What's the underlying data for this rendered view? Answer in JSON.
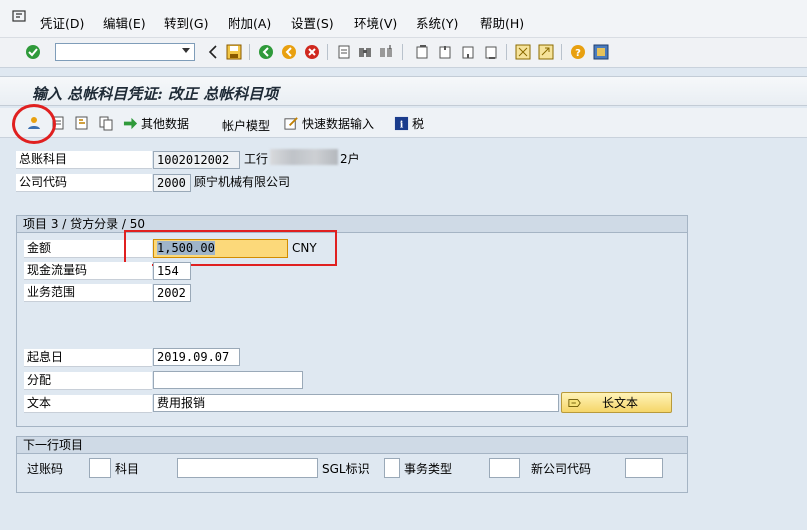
{
  "menu": {
    "items": [
      "凭证(D)",
      "编辑(E)",
      "转到(G)",
      "附加(A)",
      "设置(S)",
      "环境(V)",
      "系统(Y)",
      "帮助(H)"
    ]
  },
  "toolbar": {
    "command_field_value": ""
  },
  "title": "输入 总帐科目凭证: 改正 总帐科目项",
  "app_toolbar": {
    "other_data": "其他数据",
    "account_model": "帐户模型",
    "fast_entry": "快速数据输入",
    "tax": "税"
  },
  "header_fields": {
    "gl_account_label": "总账科目",
    "gl_account_value": "1002012002",
    "gl_account_desc_prefix": "工行",
    "gl_account_desc_suffix": "2户",
    "company_code_label": "公司代码",
    "company_code_value": "2000",
    "company_name": "顾宁机械有限公司"
  },
  "item_group": {
    "title": "项目 3 / 贷方分录 / 50",
    "amount_label": "金额",
    "amount_value": "1,500.00",
    "currency": "CNY",
    "cashflow_label": "现金流量码",
    "cashflow_value": "154",
    "business_area_label": "业务范围",
    "business_area_value": "2002",
    "value_date_label": "起息日",
    "value_date_value": "2019.09.07",
    "assignment_label": "分配",
    "assignment_value": "",
    "text_label": "文本",
    "text_value": "费用报销",
    "long_text_button": "长文本"
  },
  "next_item_group": {
    "title": "下一行项目",
    "posting_key_label": "过账码",
    "account_label": "科目",
    "sgl_label": "SGL标识",
    "trans_type_label": "事务类型",
    "new_company_label": "新公司代码"
  },
  "colors": {
    "background": "#dfe8f1",
    "highlight_red": "#e02020",
    "amount_field": "#fcd97a"
  }
}
